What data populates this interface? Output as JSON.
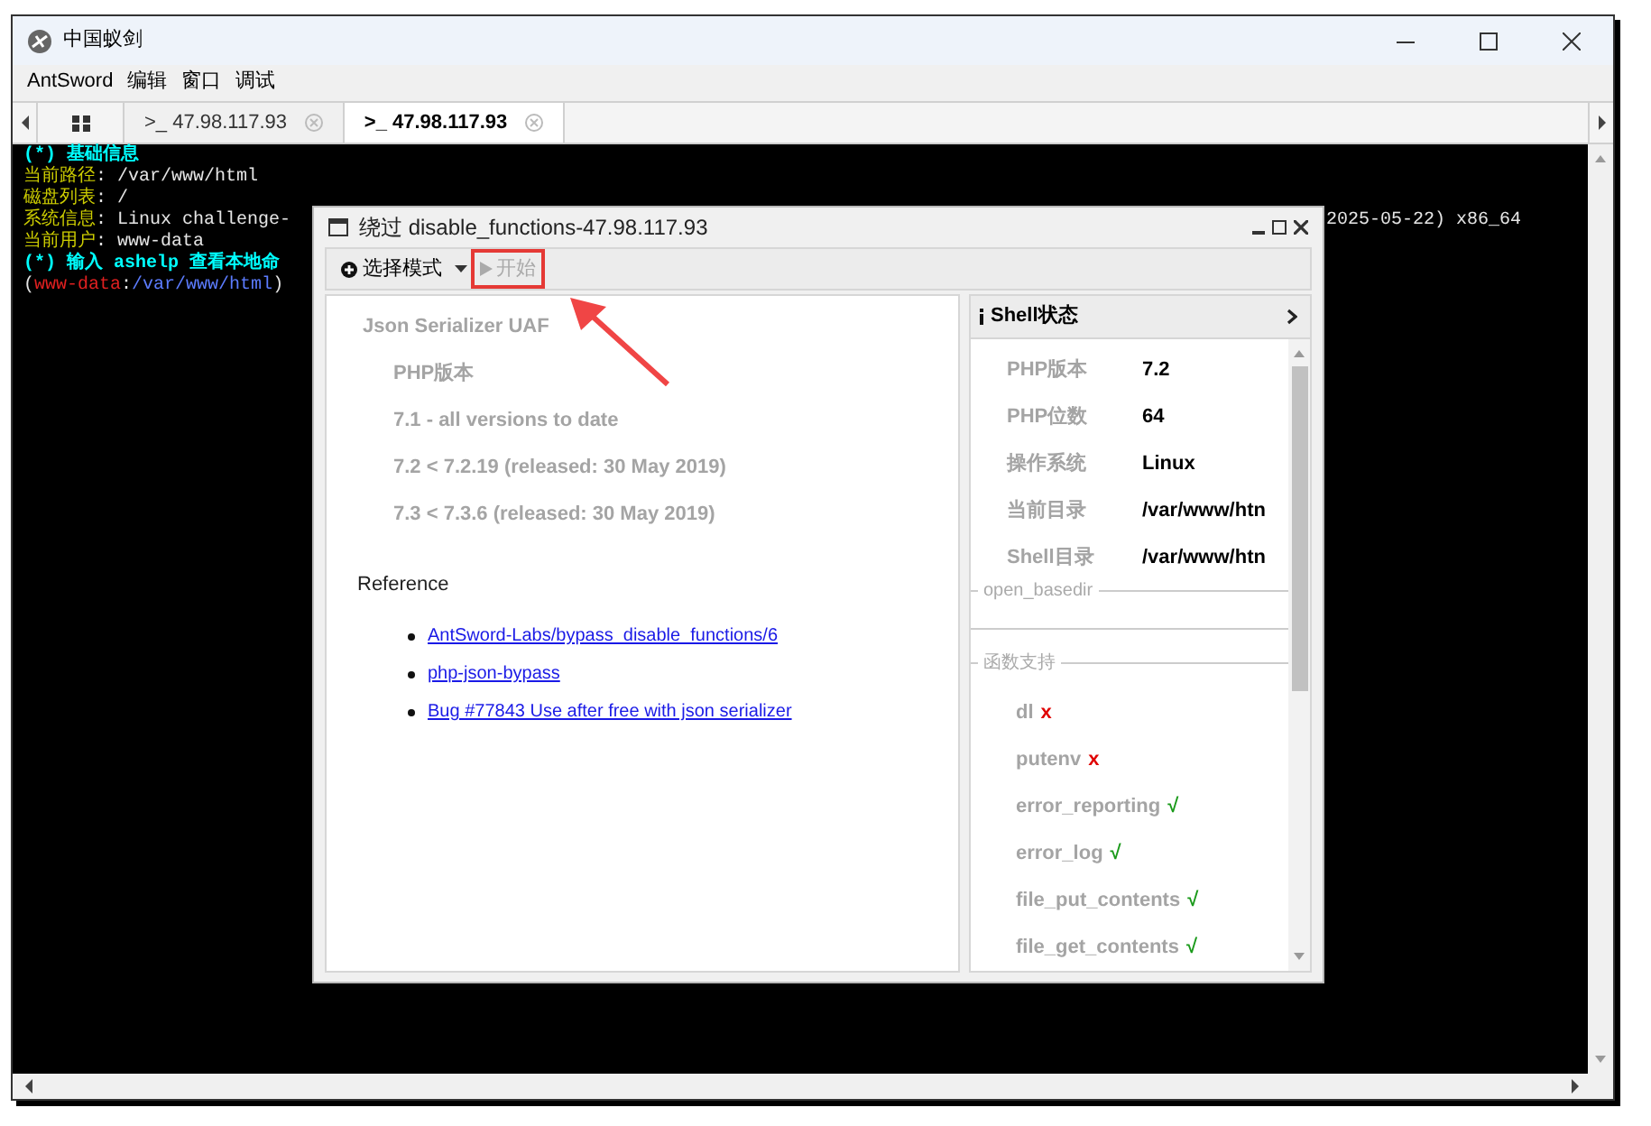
{
  "window": {
    "title": "中国蚁剑"
  },
  "menu": [
    "AntSword",
    "编辑",
    "窗口",
    "调试"
  ],
  "tabs": [
    {
      "label": ">_ 47.98.117.93",
      "selected": false
    },
    {
      "label": ">_ 47.98.117.93",
      "selected": true
    }
  ],
  "terminal": {
    "lines": [
      {
        "segments": [
          {
            "text": "(*) 基础信息",
            "color": "#00ffff"
          }
        ]
      },
      {
        "segments": [
          {
            "text": "当前路径",
            "color": "#cdcd00"
          },
          {
            "text": ": /var/www/html",
            "color": "#e5e5e5"
          }
        ]
      },
      {
        "segments": [
          {
            "text": "磁盘列表",
            "color": "#cdcd00"
          },
          {
            "text": ": /",
            "color": "#e5e5e5"
          }
        ]
      },
      {
        "segments": [
          {
            "text": "系统信息",
            "color": "#cdcd00"
          },
          {
            "text": ": Linux challenge-",
            "color": "#e5e5e5"
          }
        ],
        "tail": "2025-05-22) x86_64"
      },
      {
        "segments": [
          {
            "text": "当前用户",
            "color": "#cdcd00"
          },
          {
            "text": ": www-data",
            "color": "#e5e5e5"
          }
        ]
      },
      {
        "segments": [
          {
            "text": "(*) 输入 ashelp 查看本地命",
            "color": "#00ffff"
          }
        ]
      },
      {
        "segments": [
          {
            "text": "(",
            "color": "#e5e5e5"
          },
          {
            "text": "www-data",
            "color": "#e02020"
          },
          {
            "text": ":",
            "color": "#e5e5e5"
          },
          {
            "text": "/var/www/html",
            "color": "#5c7cff"
          },
          {
            "text": ")",
            "color": "#e5e5e5"
          }
        ]
      }
    ]
  },
  "dialog": {
    "title": "绕过 disable_functions-47.98.117.93",
    "toolbar": [
      {
        "kind": "dropdown",
        "label": "选择模式",
        "disabled": false,
        "highlighted": false
      },
      {
        "kind": "button",
        "label": "开始",
        "disabled": true,
        "highlighted": true
      }
    ],
    "content": {
      "heading": "Json Serializer UAF",
      "subheading": "PHP版本",
      "versions": [
        "7.1 - all versions to date",
        "7.2 < 7.2.19 (released: 30 May 2019)",
        "7.3 < 7.3.6 (released: 30 May 2019)"
      ],
      "reference_title": "Reference",
      "links": [
        "AntSword-Labs/bypass_disable_functions/6",
        "php-json-bypass",
        "Bug #77843 Use after free with json serializer"
      ]
    },
    "shell_panel": {
      "title": "Shell状态",
      "info": [
        {
          "label": "PHP版本",
          "value": "7.2"
        },
        {
          "label": "PHP位数",
          "value": "64"
        },
        {
          "label": "操作系统",
          "value": "Linux"
        },
        {
          "label": "当前目录",
          "value": "/var/www/htn"
        },
        {
          "label": "Shell目录",
          "value": "/var/www/htn"
        }
      ],
      "open_basedir_legend": "open_basedir",
      "functions_legend": "函数支持",
      "functions": [
        {
          "name": "dl",
          "supported": false,
          "mark": "x"
        },
        {
          "name": "putenv",
          "supported": false,
          "mark": "x"
        },
        {
          "name": "error_reporting",
          "supported": true,
          "mark": "√"
        },
        {
          "name": "error_log",
          "supported": true,
          "mark": "√"
        },
        {
          "name": "file_put_contents",
          "supported": true,
          "mark": "√"
        },
        {
          "name": "file_get_contents",
          "supported": true,
          "mark": "√"
        }
      ]
    }
  }
}
